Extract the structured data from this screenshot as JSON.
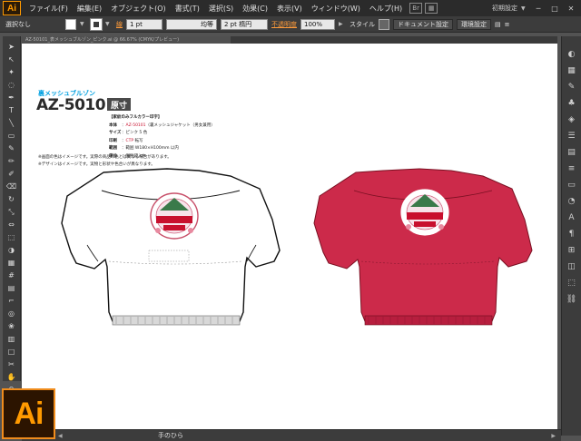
{
  "app": {
    "logo_small": "Ai",
    "logo_big": "Ai",
    "accent": "#ff9a00"
  },
  "menu": {
    "items": [
      "ファイル(F)",
      "編集(E)",
      "オブジェクト(O)",
      "書式(T)",
      "選択(S)",
      "効果(C)",
      "表示(V)",
      "ウィンドウ(W)",
      "ヘルプ(H)"
    ],
    "workspace": "初期設定"
  },
  "controlbar": {
    "selection": "選択なし",
    "stroke_label": "線",
    "stroke_weight": "1 pt",
    "profile": "均等",
    "brush": "2 pt 楕円",
    "opacity_label": "不透明度",
    "opacity_value": "100%",
    "style_label": "スタイル",
    "doc_settings": "ドキュメント設定",
    "env_settings": "環境設定"
  },
  "document": {
    "tab_title": "AZ-50101_表メッシュブルゾン_ピンク.ai @ 66.67% (CMYK/プレビュー)",
    "subtitle": "裏メッシュブルゾン",
    "code": "AZ-50101",
    "badge": "原寸",
    "spec_header": "【家紋のみフルカラー印字】",
    "spec": [
      {
        "label": "本体",
        "value_red": "AZ-50101",
        "value": "（裏メッシュジャケット（男女兼用）"
      },
      {
        "label": "サイズ",
        "value_red": "",
        "value": "ピンク 5 色"
      },
      {
        "label": "印刷",
        "value_red": "CTP",
        "value": "転写"
      },
      {
        "label": "範囲",
        "value_red": "",
        "value": "範囲 W180×H100mm 以内"
      },
      {
        "label": "単位",
        "value_red": "",
        "value": "個別袋入れ"
      }
    ],
    "notes": [
      "※画面の色はイメージです。実際の商品の色とは異なる場合があります。",
      "※デザインはイメージです。実物と形状や色合いが異なります。"
    ],
    "jacket_colors": {
      "white": "#ffffff",
      "red": "#cc2a4a",
      "rib": "#d8d8d8"
    }
  },
  "status": {
    "tool": "手のひら"
  }
}
